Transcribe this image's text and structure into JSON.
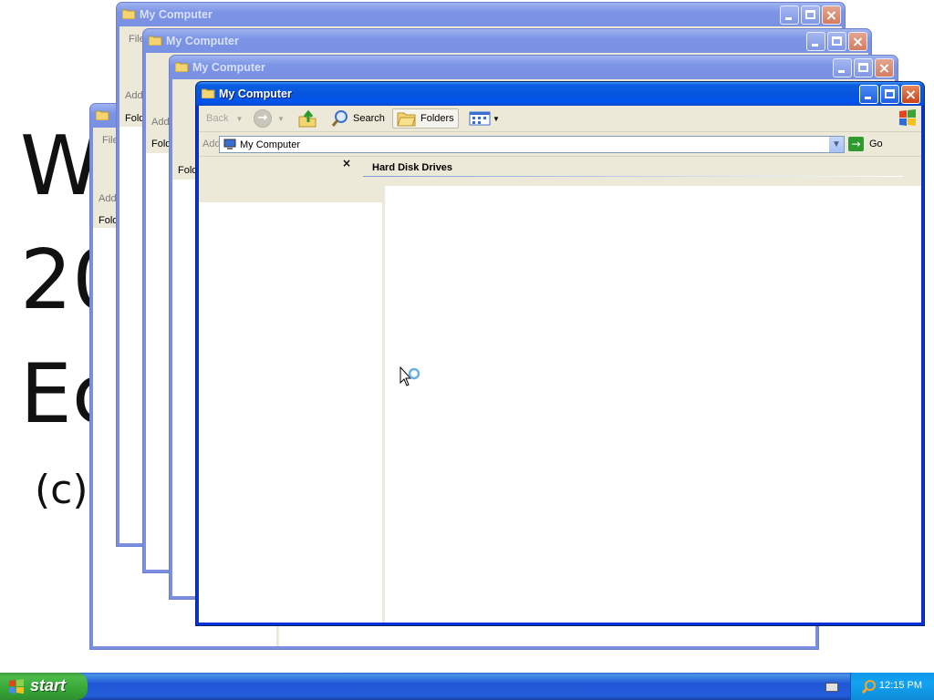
{
  "desktop": {
    "lines": [
      "W",
      "20",
      "Ec",
      "(c)"
    ]
  },
  "windows": {
    "title": "My Computer",
    "background_menu_fragments": [
      "File",
      "Add",
      "Fold"
    ]
  },
  "active_window": {
    "title": "My Computer",
    "toolbar": {
      "back_label": "Back",
      "search_label": "Search",
      "folders_label": "Folders"
    },
    "address": {
      "label": "Address",
      "value": "My Computer",
      "go_label": "Go"
    },
    "folders_pane": {
      "close_glyph": "×"
    },
    "column_header": "Hard Disk Drives"
  },
  "taskbar": {
    "start_label": "start",
    "clock": "12:15 PM"
  },
  "colors": {
    "active_title": "#0855dd",
    "inactive_title": "#7a91e3",
    "taskbar": "#245edb",
    "start": "#37a837"
  }
}
